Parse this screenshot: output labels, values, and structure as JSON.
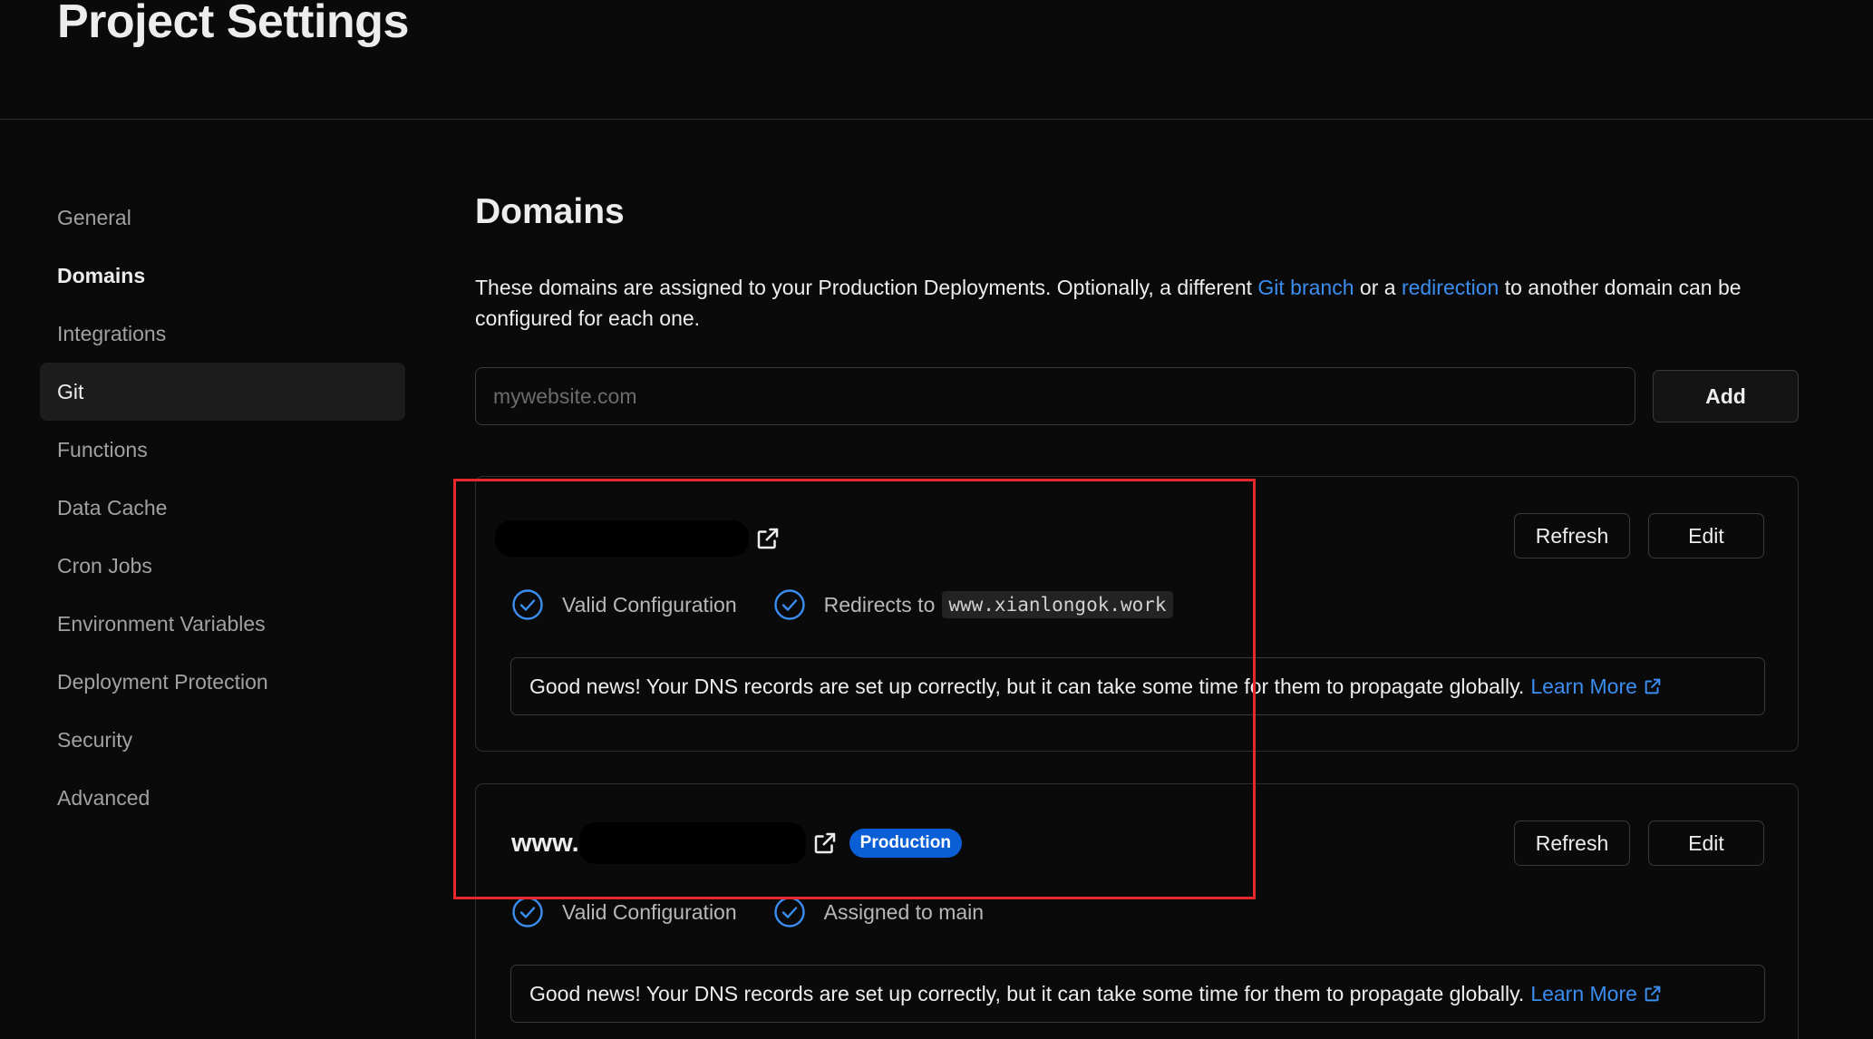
{
  "header": {
    "title": "Project Settings"
  },
  "sidebar": {
    "items": [
      {
        "label": "General"
      },
      {
        "label": "Domains"
      },
      {
        "label": "Integrations"
      },
      {
        "label": "Git"
      },
      {
        "label": "Functions"
      },
      {
        "label": "Data Cache"
      },
      {
        "label": "Cron Jobs"
      },
      {
        "label": "Environment Variables"
      },
      {
        "label": "Deployment Protection"
      },
      {
        "label": "Security"
      },
      {
        "label": "Advanced"
      }
    ]
  },
  "main": {
    "title": "Domains",
    "description": {
      "part1": "These domains are assigned to your Production Deployments. Optionally, a different ",
      "link1": "Git branch",
      "part2": " or a ",
      "link2": "redirection",
      "part3": " to another domain can be configured for each one."
    },
    "input": {
      "placeholder": "mywebsite.com",
      "value": ""
    },
    "add_label": "Add",
    "domains": [
      {
        "name_prefix": "",
        "refresh_label": "Refresh",
        "edit_label": "Edit",
        "status1": "Valid Configuration",
        "status2": "Redirects to",
        "redirect_target": "www.xianlongok.work",
        "notice": "Good news! Your DNS records are set up correctly, but it can take some time for them to propagate globally.",
        "learn_more": "Learn More"
      },
      {
        "name_prefix": "www.",
        "badge": "Production",
        "refresh_label": "Refresh",
        "edit_label": "Edit",
        "status1": "Valid Configuration",
        "status2": "Assigned to main",
        "notice": "Good news! Your DNS records are set up correctly, but it can take some time for them to propagate globally.",
        "learn_more": "Learn More"
      }
    ]
  },
  "colors": {
    "background": "#0a0a0a",
    "link": "#3b8df0",
    "check": "#3b8df0",
    "badge": "#0a5fd6",
    "highlight": "#e8282b"
  },
  "icons": {
    "external": "external-link-icon",
    "check": "check-circle-icon"
  }
}
